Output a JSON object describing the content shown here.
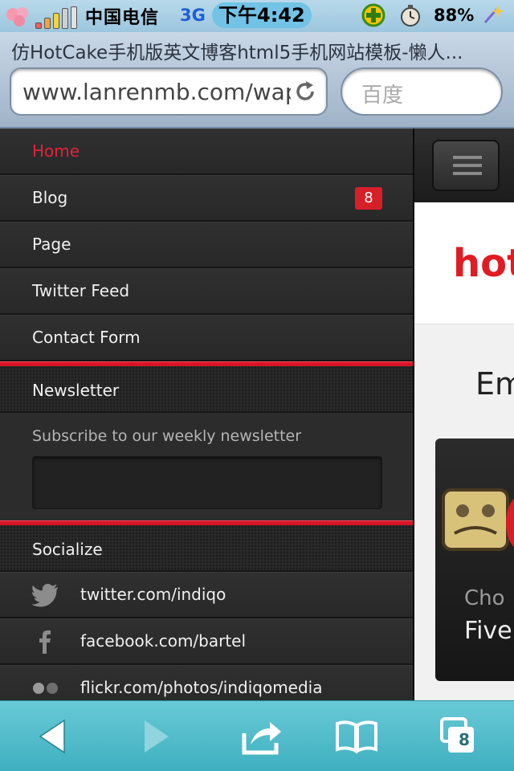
{
  "status_bar": {
    "carrier": "中国电信",
    "network": "3G",
    "time": "下午4:42",
    "battery": "88%"
  },
  "browser": {
    "page_title": "仿HotCake手机版英文博客html5手机网站模板-懒人...",
    "url": "www.lanrenmb.com/wap",
    "search_placeholder": "百度",
    "tabs_count": "8"
  },
  "sidebar": {
    "menu": [
      {
        "label": "Home",
        "active": true
      },
      {
        "label": "Blog",
        "badge": "8"
      },
      {
        "label": "Page"
      },
      {
        "label": "Twitter Feed"
      },
      {
        "label": "Contact Form"
      }
    ],
    "newsletter": {
      "heading": "Newsletter",
      "description": "Subscribe to our weekly newsletter",
      "input_value": ""
    },
    "socialize": {
      "heading": "Socialize",
      "items": [
        {
          "icon": "twitter-icon",
          "label": "twitter.com/indiqo"
        },
        {
          "icon": "facebook-icon",
          "label": "facebook.com/bartel"
        },
        {
          "icon": "flickr-icon",
          "label": "flickr.com/photos/indiqomedia"
        }
      ]
    }
  },
  "content": {
    "logo_text": "hot",
    "heading": "Em",
    "promo_line1": "Cho",
    "promo_line2": "Five"
  },
  "colors": {
    "accent_red": "#d71f28",
    "active_link": "#e5213a",
    "toolbar": "#4fbccb"
  }
}
